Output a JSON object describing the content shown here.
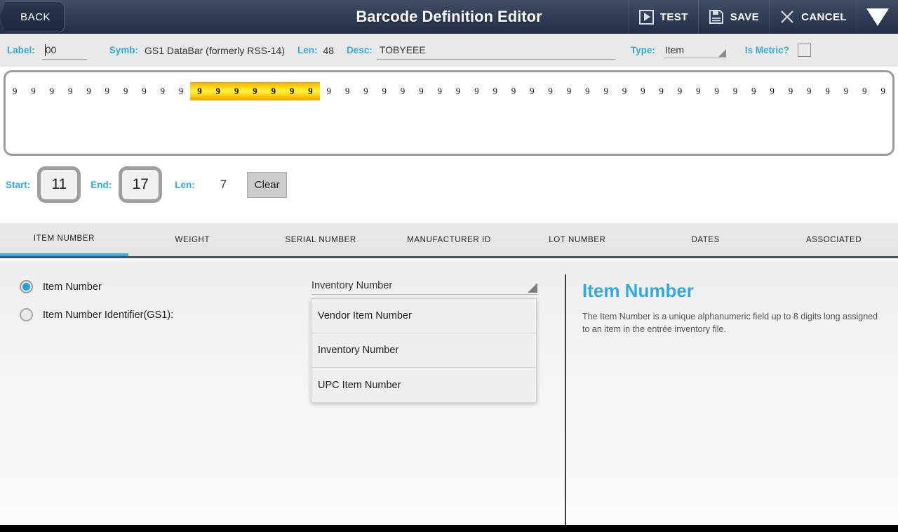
{
  "header": {
    "back_label": "BACK",
    "title": "Barcode Definition Editor",
    "actions": [
      {
        "label": "TEST",
        "icon": "play-icon"
      },
      {
        "label": "SAVE",
        "icon": "save-icon"
      },
      {
        "label": "CANCEL",
        "icon": "close-icon"
      }
    ],
    "overflow_icon": "triangle-down-icon",
    "accent": "#2fabe1"
  },
  "infobar": {
    "label_label": "Label:",
    "label_value": "00",
    "symb_label": "Symb:",
    "symb_value": "GS1 DataBar (formerly RSS-14)",
    "len_label": "Len:",
    "len_value": "48",
    "desc_label": "Desc:",
    "desc_value": "TOBYEEE",
    "type_label": "Type:",
    "type_value": "Item",
    "is_metric_label": "Is Metric?",
    "is_metric_checked": false
  },
  "barcode": {
    "character": "9",
    "total_length": 48,
    "highlight_start": 11,
    "highlight_end": 17,
    "highlight_color": "#ffd500"
  },
  "range": {
    "start_label": "Start:",
    "start_value": "11",
    "end_label": "End:",
    "end_value": "17",
    "len_label": "Len:",
    "len_value": "7",
    "clear_label": "Clear"
  },
  "tabs": {
    "active_index": 0,
    "items": [
      {
        "label": "ITEM NUMBER"
      },
      {
        "label": "WEIGHT"
      },
      {
        "label": "SERIAL NUMBER"
      },
      {
        "label": "MANUFACTURER ID"
      },
      {
        "label": "LOT NUMBER"
      },
      {
        "label": "DATES"
      },
      {
        "label": "ASSOCIATED"
      }
    ]
  },
  "form": {
    "radios": [
      {
        "label": "Item Number",
        "selected": true
      },
      {
        "label": "Item Number Identifier(GS1):",
        "selected": false
      }
    ],
    "spinner_value": "Inventory Number",
    "dropdown_open": true,
    "dropdown_options": [
      {
        "label": "Vendor Item Number"
      },
      {
        "label": "Inventory Number"
      },
      {
        "label": "UPC Item Number"
      }
    ]
  },
  "info": {
    "title": "Item Number",
    "description": "The Item Number is a unique alphanumeric field up to 8 digits long assigned to an item in the entrée inventory file."
  }
}
